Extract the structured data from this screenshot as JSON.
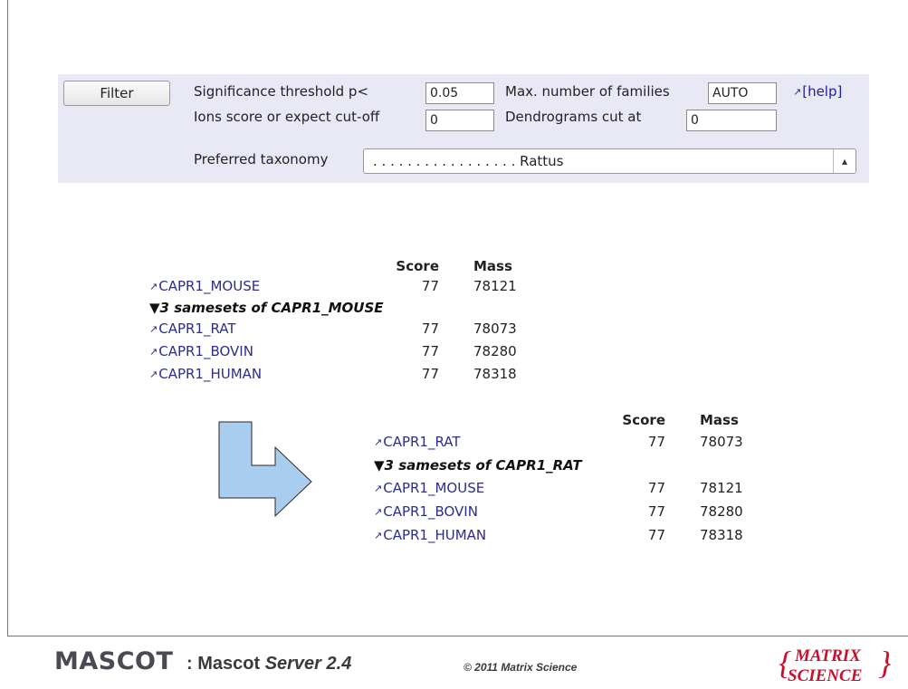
{
  "filter": {
    "button_label": "Filter",
    "significance_label": "Significance threshold p<",
    "significance_value": "0.05",
    "max_families_label": "Max. number of families",
    "max_families_value": "AUTO",
    "help_label": "[help]",
    "ions_cutoff_label": "Ions score or expect cut-off",
    "ions_cutoff_value": "0",
    "dendrogram_label": "Dendrograms cut at",
    "dendrogram_value": "0",
    "taxonomy_label": "Preferred taxonomy",
    "taxonomy_value": ". . . . . . . . . . . . . . . . . Rattus"
  },
  "table_before": {
    "headers": {
      "score": "Score",
      "mass": "Mass"
    },
    "top": {
      "accession": "CAPR1_MOUSE",
      "score": "77",
      "mass": "78121"
    },
    "sameset_label": "3 samesets of CAPR1_MOUSE",
    "samesets": [
      {
        "accession": "CAPR1_RAT",
        "score": "77",
        "mass": "78073"
      },
      {
        "accession": "CAPR1_BOVIN",
        "score": "77",
        "mass": "78280"
      },
      {
        "accession": "CAPR1_HUMAN",
        "score": "77",
        "mass": "78318"
      }
    ]
  },
  "table_after": {
    "headers": {
      "score": "Score",
      "mass": "Mass"
    },
    "top": {
      "accession": "CAPR1_RAT",
      "score": "77",
      "mass": "78073"
    },
    "sameset_label": "3 samesets of CAPR1_RAT",
    "samesets": [
      {
        "accession": "CAPR1_MOUSE",
        "score": "77",
        "mass": "78121"
      },
      {
        "accession": "CAPR1_BOVIN",
        "score": "77",
        "mass": "78280"
      },
      {
        "accession": "CAPR1_HUMAN",
        "score": "77",
        "mass": "78318"
      }
    ]
  },
  "arrow": {
    "fill": "#a9cdef",
    "stroke": "#2a2a2a"
  },
  "footer": {
    "brand": "MASCOT",
    "title_prefix": ": Mascot ",
    "title_italic": "Server 2.4",
    "copyright": "© 2011 Matrix Science",
    "logo_line1": "MATRIX",
    "logo_line2": "SCIENCE",
    "logo_color": "#c8102e"
  },
  "icons": {
    "external_link": "external-link-icon",
    "expand": "triangle-down-icon",
    "select_arrows": "updown-chevron-icon"
  }
}
